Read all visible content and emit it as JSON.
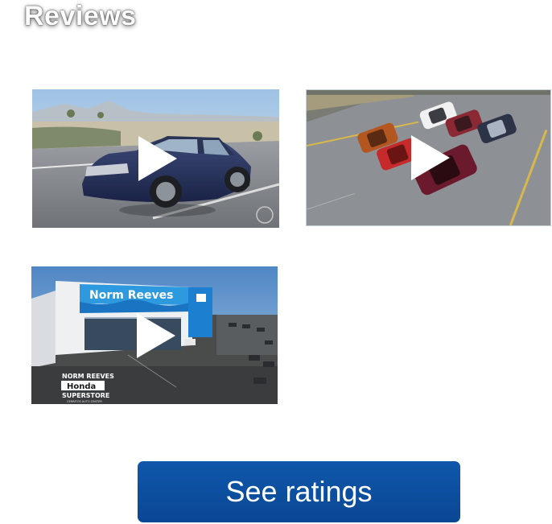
{
  "section": {
    "title": "Reviews"
  },
  "videos": [
    {
      "description_icon": "play-icon"
    },
    {
      "description_icon": "play-icon"
    },
    {
      "description_icon": "play-icon",
      "storefront_sign": "Norm Reeves",
      "logo_lines": [
        "NORM REEVES",
        "Honda",
        "SUPERSTORE"
      ],
      "logo_subline": "CERRITOS AUTO CENTER"
    }
  ],
  "actions": {
    "see_ratings_label": "See ratings"
  },
  "colors": {
    "button": "#0b4c9a",
    "title_text": "#ffffff"
  }
}
